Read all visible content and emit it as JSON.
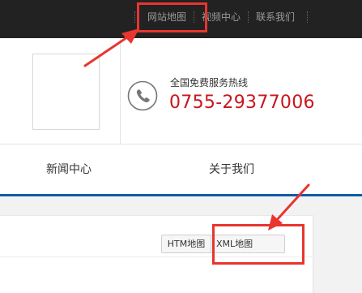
{
  "topbar": {
    "links": [
      "网站地图",
      "视频中心",
      "联系我们"
    ]
  },
  "header": {
    "logo_alt": "",
    "hotline_label": "全国免费服务热线",
    "hotline_number": "0755-29377006",
    "phone_icon": "phone-icon"
  },
  "nav": {
    "items": [
      "新闻中心",
      "关于我们"
    ]
  },
  "content": {
    "buttons": [
      "HTM地图",
      "XML地图"
    ]
  },
  "annotations": {
    "color": "#e8352f",
    "highlight_color": "#e8352f"
  },
  "colors": {
    "topbar_bg": "#222222",
    "hotline_number": "#c8161d",
    "nav_underline": "#0f5ba8"
  }
}
